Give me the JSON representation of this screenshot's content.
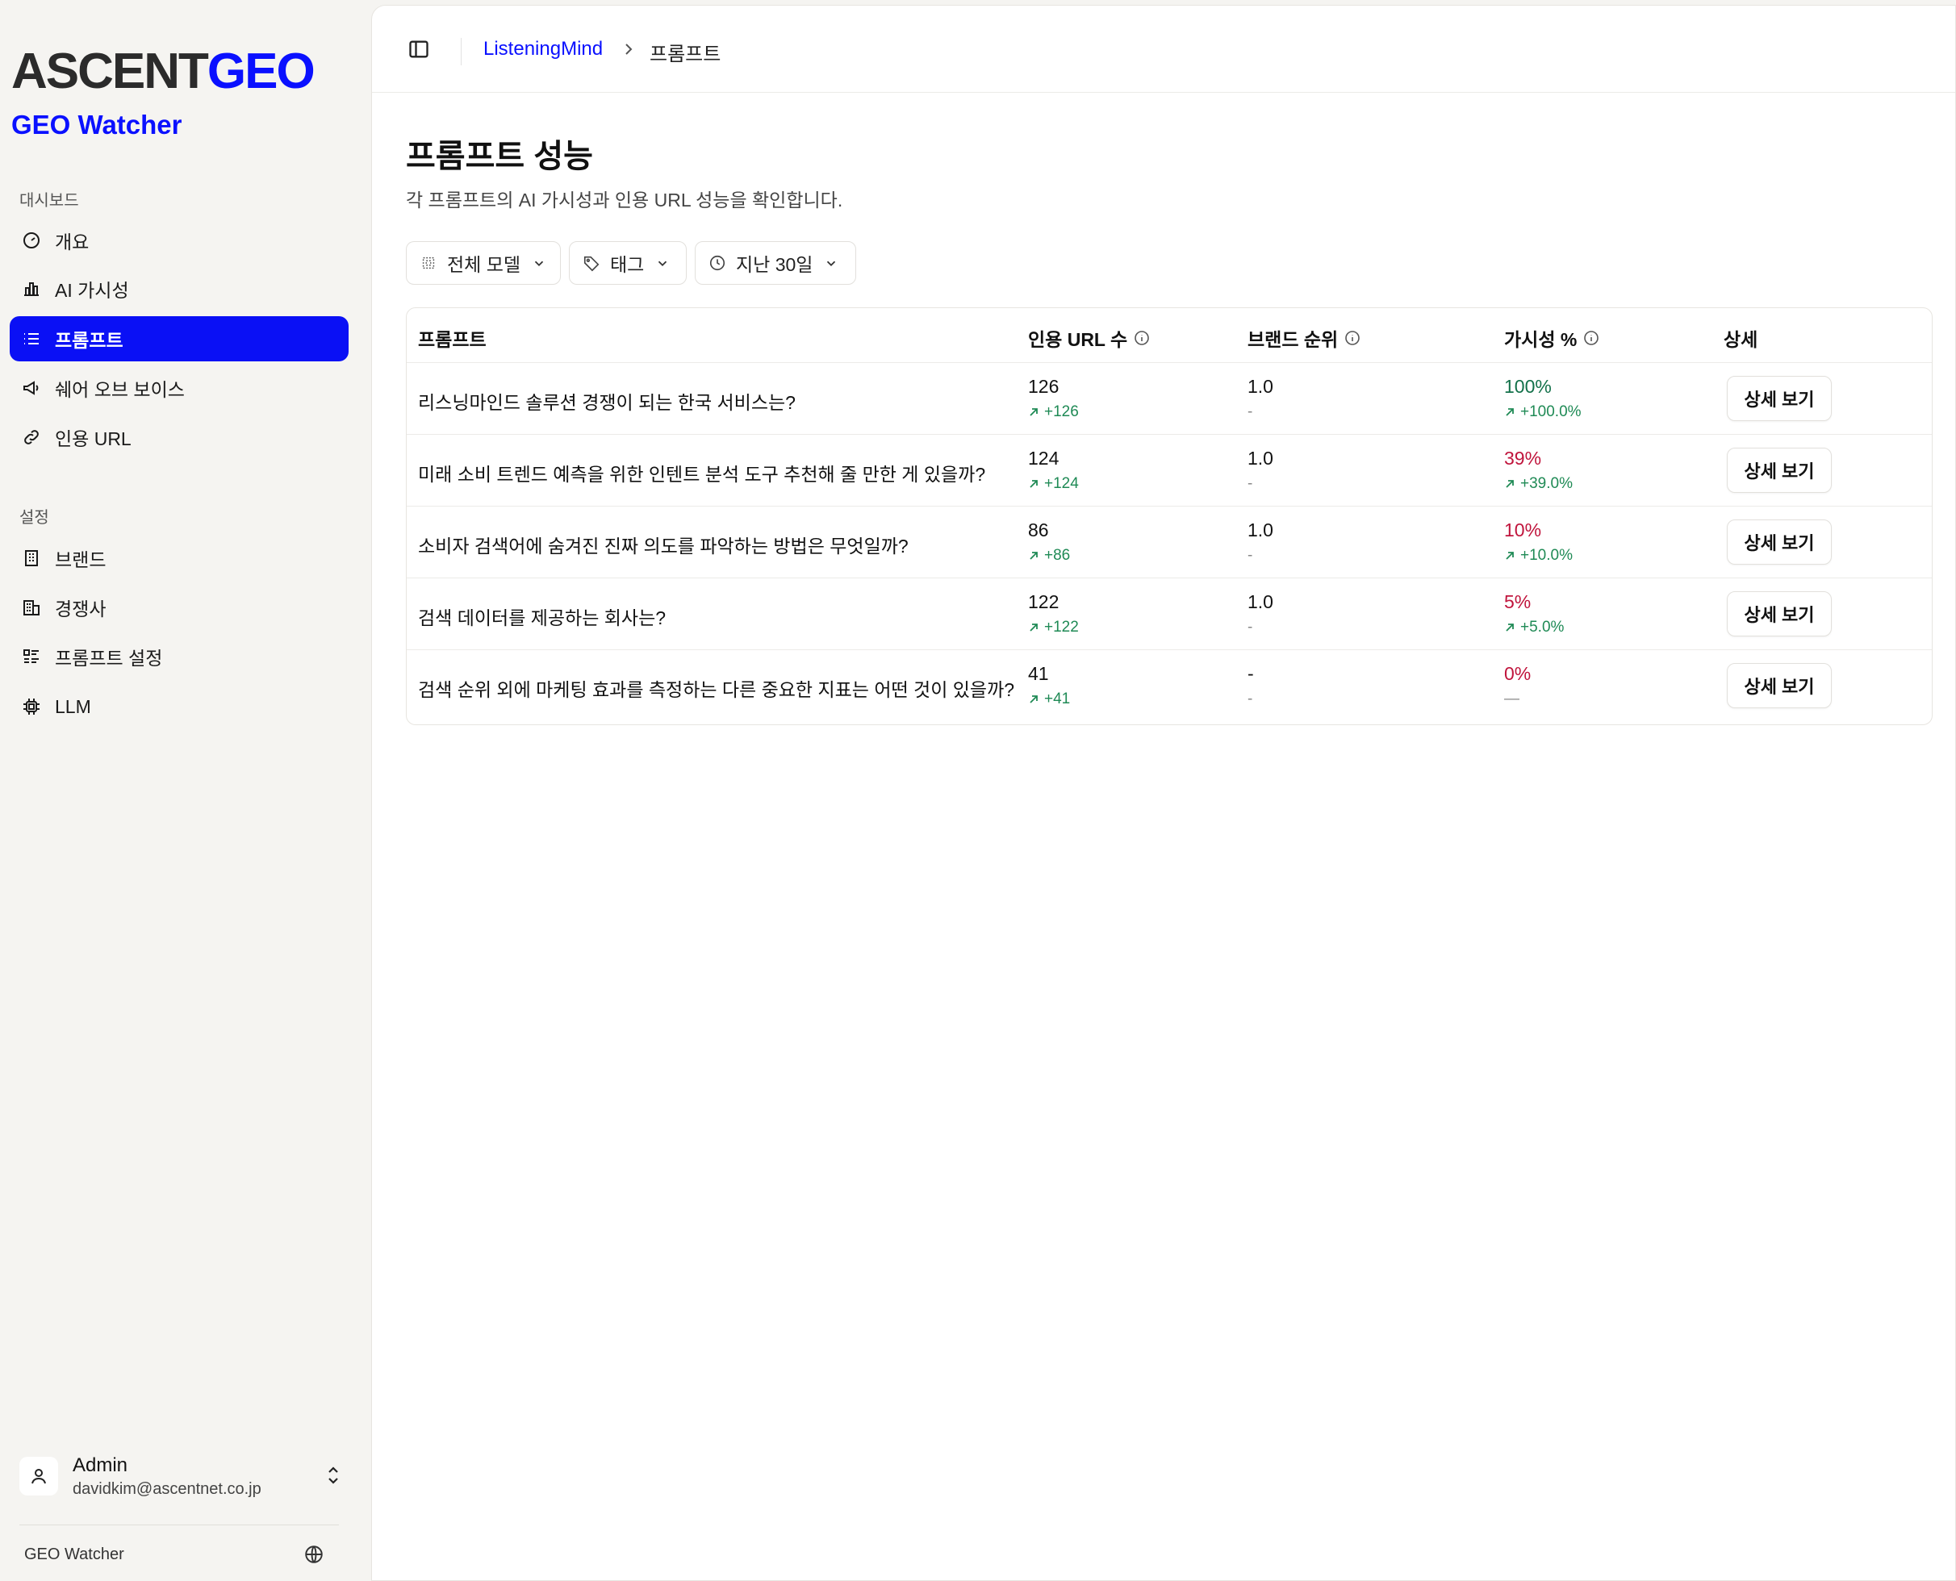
{
  "brand": {
    "logo_ascent": "ASCENT",
    "logo_geo": "GEO",
    "subtitle": "GEO Watcher"
  },
  "sidebar": {
    "section_dashboard": "대시보드",
    "dashboard_items": [
      {
        "label": "개요",
        "icon": "gauge-icon"
      },
      {
        "label": "AI 가시성",
        "icon": "bar-chart-icon"
      },
      {
        "label": "프롬프트",
        "icon": "list-icon",
        "active": true
      },
      {
        "label": "쉐어 오브 보이스",
        "icon": "megaphone-icon"
      },
      {
        "label": "인용 URL",
        "icon": "link-icon"
      }
    ],
    "section_settings": "설정",
    "settings_items": [
      {
        "label": "브랜드",
        "icon": "building-icon"
      },
      {
        "label": "경쟁사",
        "icon": "buildings-icon"
      },
      {
        "label": "프롬프트 설정",
        "icon": "list-settings-icon"
      },
      {
        "label": "LLM",
        "icon": "cpu-icon"
      }
    ],
    "user": {
      "name": "Admin",
      "email": "davidkim@ascentnet.co.jp"
    },
    "footer": "GEO Watcher"
  },
  "breadcrumb": {
    "parent": "ListeningMind",
    "current": "프롬프트"
  },
  "page": {
    "title": "프롬프트 성능",
    "description": "각 프롬프트의 AI 가시성과 인용 URL 성능을 확인합니다."
  },
  "filters": {
    "model": "전체 모델",
    "tag": "태그",
    "period": "지난 30일"
  },
  "table": {
    "headers": {
      "prompt": "프롬프트",
      "cited_urls": "인용 URL 수",
      "brand_rank": "브랜드 순위",
      "visibility": "가시성 %",
      "detail": "상세"
    },
    "rows": [
      {
        "prompt": "리스닝마인드 솔루션 경쟁이 되는 한국 서비스는?",
        "urls": "126",
        "urls_delta": "+126",
        "rank": "1.0",
        "rank_delta": "-",
        "vis": "100%",
        "vis_delta": "+100.0%",
        "vis_tone": "good",
        "button": "상세 보기"
      },
      {
        "prompt": "미래 소비 트렌드 예측을 위한 인텐트 분석 도구 추천해 줄 만한 게 있을까?",
        "urls": "124",
        "urls_delta": "+124",
        "rank": "1.0",
        "rank_delta": "-",
        "vis": "39%",
        "vis_delta": "+39.0%",
        "vis_tone": "bad",
        "button": "상세 보기"
      },
      {
        "prompt": "소비자 검색어에 숨겨진 진짜 의도를 파악하는 방법은 무엇일까?",
        "urls": "86",
        "urls_delta": "+86",
        "rank": "1.0",
        "rank_delta": "-",
        "vis": "10%",
        "vis_delta": "+10.0%",
        "vis_tone": "bad",
        "button": "상세 보기"
      },
      {
        "prompt": "검색 데이터를 제공하는 회사는?",
        "urls": "122",
        "urls_delta": "+122",
        "rank": "1.0",
        "rank_delta": "-",
        "vis": "5%",
        "vis_delta": "+5.0%",
        "vis_tone": "bad",
        "button": "상세 보기"
      },
      {
        "prompt": "검색 순위 외에 마케팅 효과를 측정하는 다른 중요한 지표는 어떤 것이 있을까?",
        "urls": "41",
        "urls_delta": "+41",
        "rank": "-",
        "rank_delta": "-",
        "vis": "0%",
        "vis_delta": "—",
        "vis_tone": "bad",
        "button": "상세 보기"
      }
    ]
  },
  "colors": {
    "accent": "#0a10ff",
    "active_bg": "#0a10f5",
    "positive": "#1f8a55",
    "negative": "#c0143c"
  }
}
